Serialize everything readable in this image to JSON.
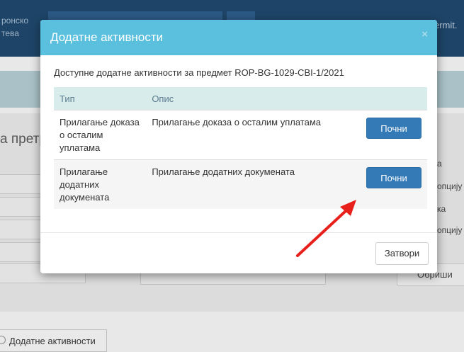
{
  "background": {
    "brand_text": "ронско\nтева",
    "user_text": "ermit.",
    "heading": "а претр",
    "right_labels": [
      "а",
      "опцију",
      "ка",
      "опцију"
    ],
    "delete_button": "Обриши",
    "bottom_button": "Додатне активности"
  },
  "modal": {
    "title": "Додатне активности",
    "close_symbol": "×",
    "subtitle": "Доступне додатне активности за предмет ROP-BG-1029-CBI-1/2021",
    "columns": [
      "Тип",
      "Опис"
    ],
    "rows": [
      {
        "type": "Прилагање доказа о осталим уплатама",
        "description": "Прилагање доказа о осталим уплатама",
        "action": "Почни"
      },
      {
        "type": "Прилагање додатних докумената",
        "description": "Прилагање додатних докумената",
        "action": "Почни"
      }
    ],
    "close_button": "Затвори"
  },
  "colors": {
    "header": "#5bc0de",
    "primary_button": "#337ab7",
    "annotation_arrow": "#e8201c"
  }
}
